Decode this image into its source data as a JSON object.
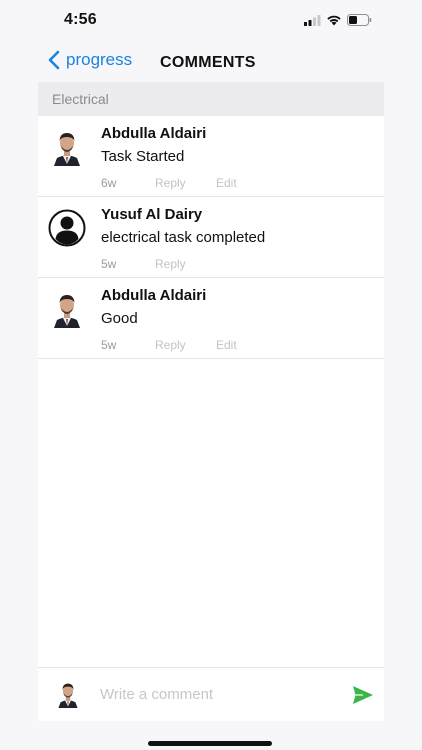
{
  "status_bar": {
    "time": "4:56",
    "icons": [
      "signal-icon",
      "wifi-icon",
      "battery-icon"
    ]
  },
  "nav": {
    "back_label": "progress",
    "title": "COMMENTS"
  },
  "section": {
    "title": "Electrical"
  },
  "comments": [
    {
      "author": "Abdulla Aldairi",
      "text": "Task Started",
      "time": "6w",
      "reply_label": "Reply",
      "edit_label": "Edit",
      "avatar": "photo"
    },
    {
      "author": "Yusuf Al Dairy",
      "text": "electrical task completed",
      "time": "5w",
      "reply_label": "Reply",
      "avatar": "default-user-icon"
    },
    {
      "author": "Abdulla Aldairi",
      "text": "Good",
      "time": "5w",
      "reply_label": "Reply",
      "edit_label": "Edit",
      "avatar": "photo"
    }
  ],
  "composer": {
    "placeholder": "Write a comment",
    "value": ""
  },
  "colors": {
    "accent": "#1a82e2",
    "send": "#3bb54a",
    "section_bg": "#ececf0"
  }
}
